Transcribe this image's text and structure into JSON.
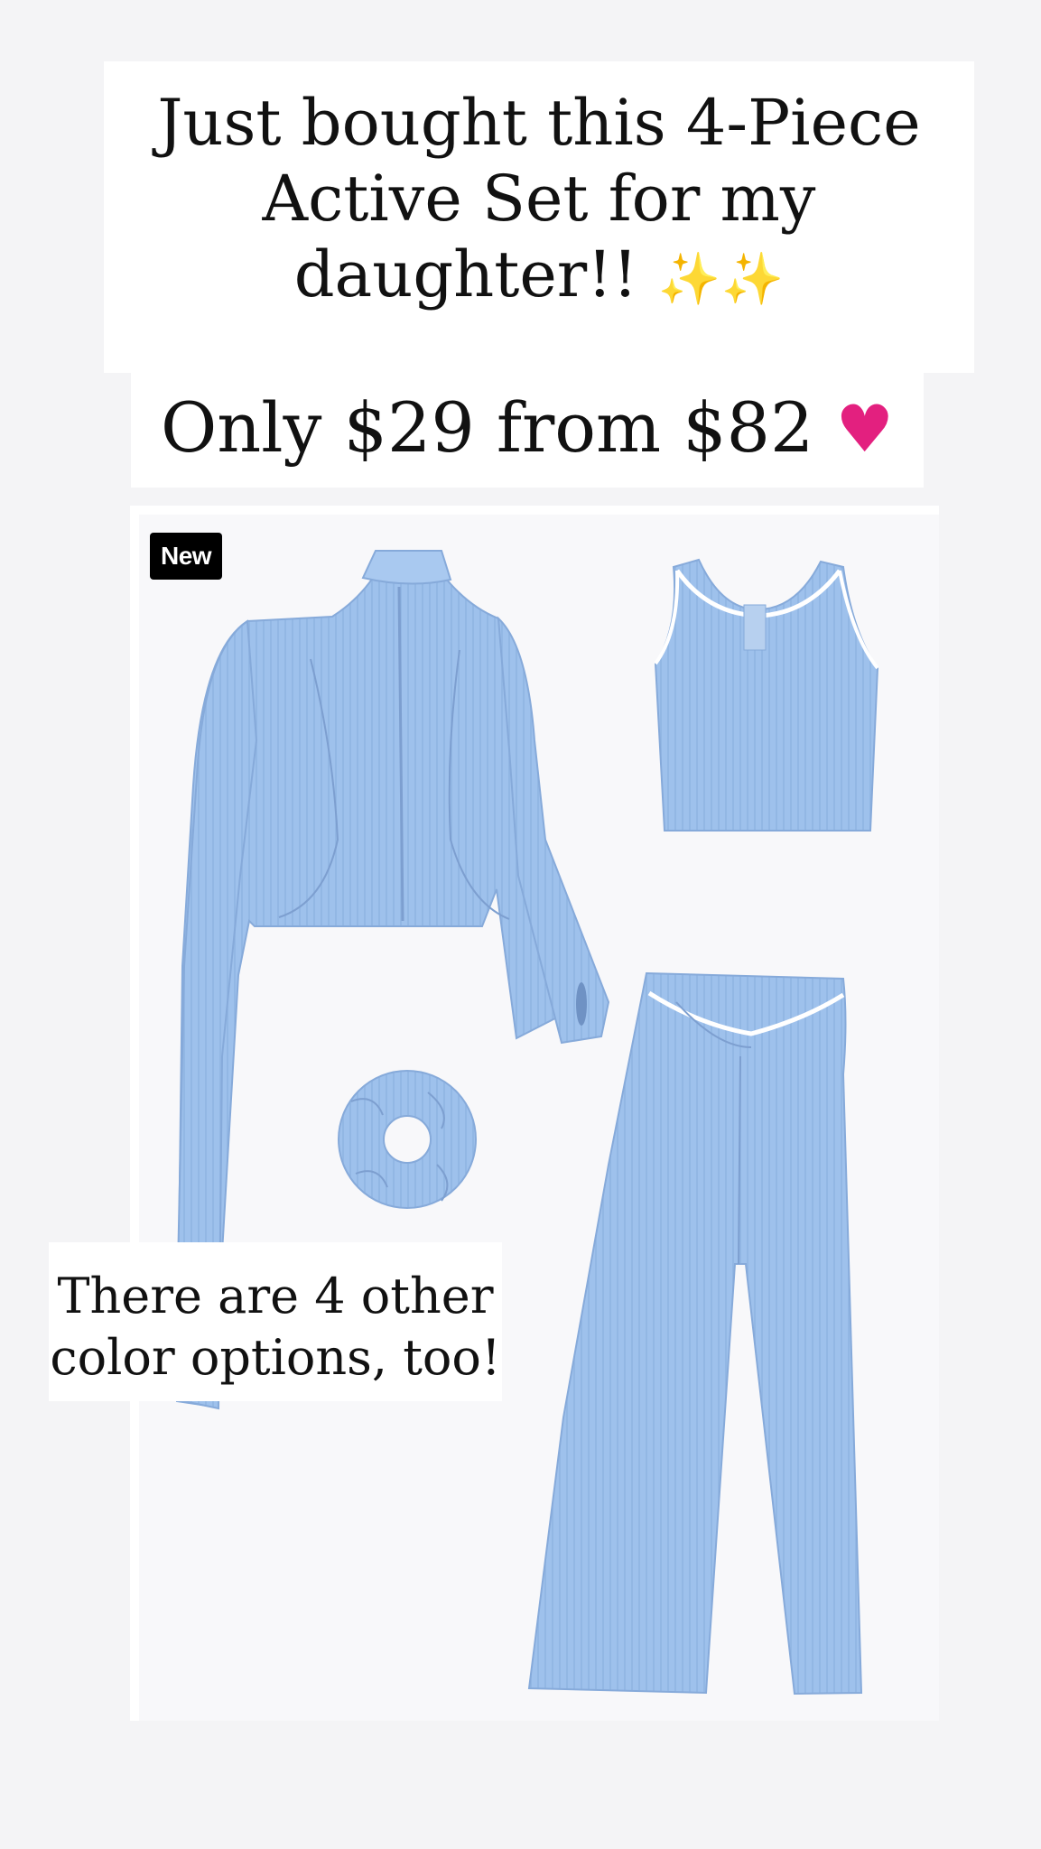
{
  "story": {
    "headline_lines": [
      "Just bought this 4-Piece",
      "Active Set for my",
      "daughter!!"
    ],
    "headline_emoji": "✨✨",
    "price_text": "Only $29 from $82",
    "price_emoji": "♥",
    "note_lines": [
      "There are 4 other",
      "color options, too!"
    ]
  },
  "product": {
    "badge_label": "New",
    "items": [
      "jacket-icon",
      "tank-top-icon",
      "scrunchie-icon",
      "leggings-icon"
    ],
    "color": "#9ec1ec"
  },
  "colors": {
    "background": "#f4f4f6",
    "caption_bg": "#ffffff",
    "product_blue": "#9ec1ec",
    "badge_bg": "#000000",
    "heart": "#e3207f",
    "sparkle": "#f2c230"
  }
}
